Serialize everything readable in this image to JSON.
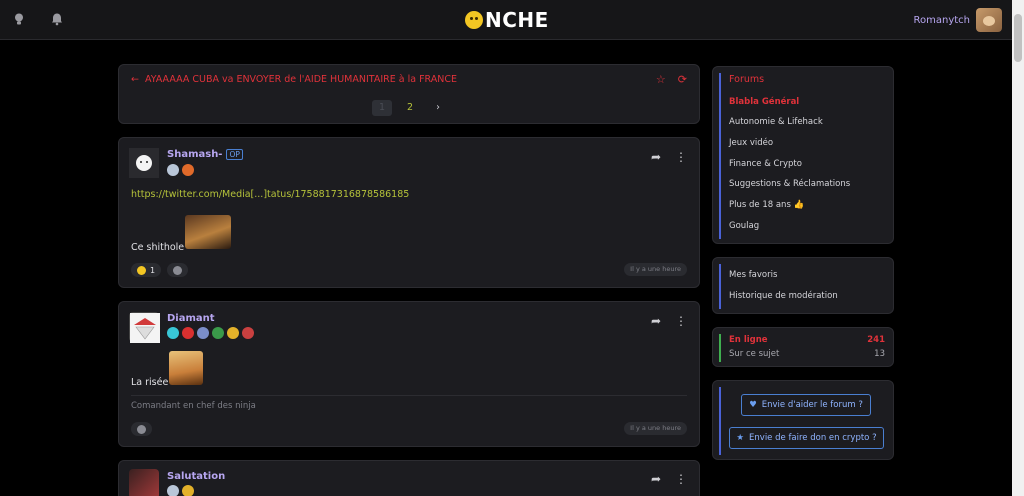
{
  "topbar": {
    "logo_text": "NCHE",
    "user_name": "Romanytch",
    "icons": [
      "lightbulb-icon",
      "bell-icon"
    ]
  },
  "thread": {
    "title": "AYAAAAA CUBA va ENVOYER de l'AIDE HUMANITAIRE à la FRANCE",
    "pages": [
      "1",
      "2"
    ],
    "next_label": "›"
  },
  "posts": [
    {
      "author": "Shamash-",
      "op_badge": "OP",
      "link": "https://twitter.com/Media[...]tatus/1758817316878586185",
      "text": "Ce shithole",
      "reaction_count": "1",
      "time": "Il y a une heure"
    },
    {
      "author": "Diamant",
      "text": "La risée",
      "signature": "Comandant en chef des ninja",
      "time": "Il y a une heure"
    },
    {
      "author": "Salutation"
    }
  ],
  "sidebar": {
    "forums_title": "Forums",
    "forums": [
      "Blabla Général",
      "Autonomie & Lifehack",
      "Jeux vidéo",
      "Finance & Crypto",
      "Suggestions & Réclamations",
      "Plus de 18 ans 👍",
      "Goulag"
    ],
    "links": [
      "Mes favoris",
      "Historique de modération"
    ],
    "online_label": "En ligne",
    "online_count": "241",
    "topic_label": "Sur ce sujet",
    "topic_count": "13",
    "help_button": "Envie d'aider le forum ?",
    "crypto_button": "Envie de faire don en crypto ?"
  },
  "colors": {
    "accent_red": "#e0323a",
    "username": "#b7a6f0",
    "link_green": "#b5c23a",
    "blue": "#4a7fd1"
  }
}
